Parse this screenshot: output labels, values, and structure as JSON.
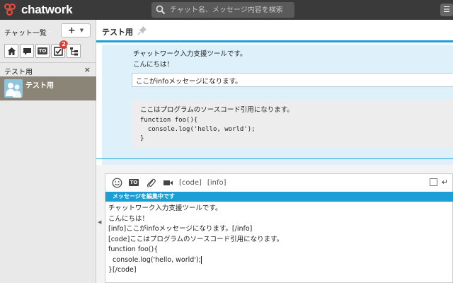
{
  "app": {
    "logo_text": "chatwork",
    "brand_color": "#e2513a",
    "accent_color": "#1c9fd6"
  },
  "search": {
    "placeholder": "チャット名、メッセージ内容を検索"
  },
  "sidebar": {
    "title": "チャット一覧",
    "add_label": "+",
    "filters": [
      {
        "icon": "home-icon"
      },
      {
        "icon": "speech-bubble-icon"
      },
      {
        "icon": "to-icon",
        "label": "TO"
      },
      {
        "icon": "task-check-icon",
        "badge": "2"
      },
      {
        "icon": "tree-structure-icon"
      }
    ],
    "group_title": "テスト用",
    "group_close": "×",
    "rooms": [
      {
        "name": "テスト用"
      }
    ]
  },
  "room": {
    "title": "テスト用"
  },
  "message": {
    "line1": "チャットワーク入力支援ツールです。",
    "line2": "こんにちは！",
    "info_text": "ここがinfoメッセージになります。",
    "code_title": "ここはプログラムのソースコード引用になります。",
    "code_lines": [
      "function foo(){",
      "  console.log('hello, world');",
      "}"
    ]
  },
  "composer": {
    "tags": [
      "[code]",
      "[info]"
    ],
    "editing_label": "メッセージを編集中です",
    "text_lines": [
      "チャットワーク入力支援ツールです。",
      "こんにちは！",
      "[info]ここがinfoメッセージになります。[/info]",
      "[code]ここはプログラムのソースコード引用になります。",
      "function foo(){",
      "  console.log('hello, world');",
      "}[/code]"
    ]
  }
}
